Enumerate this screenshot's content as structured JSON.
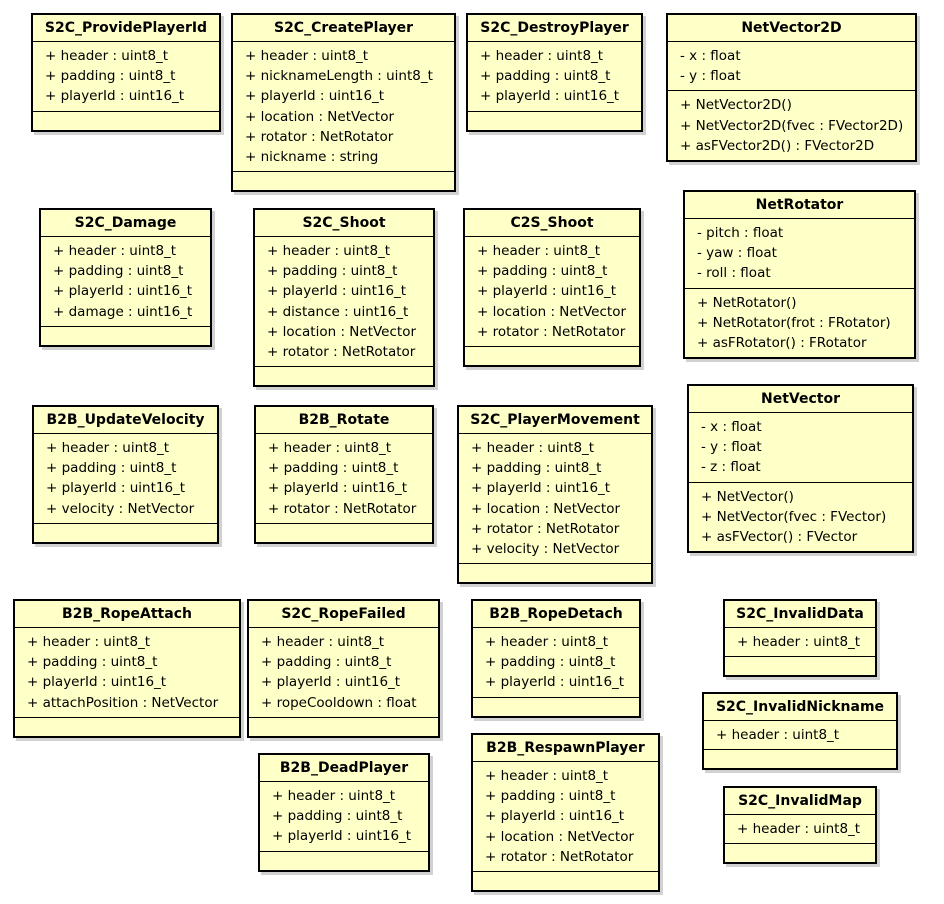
{
  "classes": {
    "s2c_provideplayerid": {
      "name": "S2C_ProvidePlayerId",
      "fields": [
        "+ header : uint8_t",
        "+ padding : uint8_t",
        "+ playerId : uint16_t"
      ],
      "methods": []
    },
    "s2c_createplayer": {
      "name": "S2C_CreatePlayer",
      "fields": [
        "+ header : uint8_t",
        "+ nicknameLength : uint8_t",
        "+ playerId : uint16_t",
        "+ location : NetVector",
        "+ rotator : NetRotator",
        "+ nickname : string"
      ],
      "methods": []
    },
    "s2c_destroyplayer": {
      "name": "S2C_DestroyPlayer",
      "fields": [
        "+ header : uint8_t",
        "+ padding : uint8_t",
        "+ playerId : uint16_t"
      ],
      "methods": []
    },
    "netvector2d": {
      "name": "NetVector2D",
      "fields": [
        "- x : float",
        "- y : float"
      ],
      "methods": [
        "+ NetVector2D()",
        "+ NetVector2D(fvec : FVector2D)",
        "+ asFVector2D() : FVector2D"
      ]
    },
    "s2c_damage": {
      "name": "S2C_Damage",
      "fields": [
        "+ header : uint8_t",
        "+ padding : uint8_t",
        "+ playerId : uint16_t",
        "+ damage : uint16_t"
      ],
      "methods": []
    },
    "s2c_shoot": {
      "name": "S2C_Shoot",
      "fields": [
        "+ header : uint8_t",
        "+ padding : uint8_t",
        "+ playerId : uint16_t",
        "+ distance : uint16_t",
        "+ location : NetVector",
        "+ rotator : NetRotator"
      ],
      "methods": []
    },
    "c2s_shoot": {
      "name": "C2S_Shoot",
      "fields": [
        "+ header : uint8_t",
        "+ padding : uint8_t",
        "+ playerId : uint16_t",
        "+ location : NetVector",
        "+ rotator : NetRotator"
      ],
      "methods": []
    },
    "netrotator": {
      "name": "NetRotator",
      "fields": [
        "- pitch : float",
        "- yaw : float",
        "- roll : float"
      ],
      "methods": [
        "+ NetRotator()",
        "+ NetRotator(frot : FRotator)",
        "+ asFRotator() : FRotator"
      ]
    },
    "b2b_updatevelocity": {
      "name": "B2B_UpdateVelocity",
      "fields": [
        "+ header : uint8_t",
        "+ padding : uint8_t",
        "+ playerId : uint16_t",
        "+ velocity : NetVector"
      ],
      "methods": []
    },
    "b2b_rotate": {
      "name": "B2B_Rotate",
      "fields": [
        "+ header : uint8_t",
        "+ padding : uint8_t",
        "+ playerId : uint16_t",
        "+ rotator : NetRotator"
      ],
      "methods": []
    },
    "s2c_playermovement": {
      "name": "S2C_PlayerMovement",
      "fields": [
        "+ header : uint8_t",
        "+ padding : uint8_t",
        "+ playerId : uint16_t",
        "+ location : NetVector",
        "+ rotator : NetRotator",
        "+ velocity : NetVector"
      ],
      "methods": []
    },
    "netvector": {
      "name": "NetVector",
      "fields": [
        "- x : float",
        "- y : float",
        "- z : float"
      ],
      "methods": [
        "+ NetVector()",
        "+ NetVector(fvec : FVector)",
        "+ asFVector() : FVector"
      ]
    },
    "b2b_ropeattach": {
      "name": "B2B_RopeAttach",
      "fields": [
        "+ header : uint8_t",
        "+ padding : uint8_t",
        "+ playerId : uint16_t",
        "+ attachPosition : NetVector"
      ],
      "methods": []
    },
    "s2c_ropefailed": {
      "name": "S2C_RopeFailed",
      "fields": [
        "+ header : uint8_t",
        "+ padding : uint8_t",
        "+ playerId : uint16_t",
        "+ ropeCooldown : float"
      ],
      "methods": []
    },
    "b2b_ropedetach": {
      "name": "B2B_RopeDetach",
      "fields": [
        "+ header : uint8_t",
        "+ padding : uint8_t",
        "+ playerId : uint16_t"
      ],
      "methods": []
    },
    "s2c_invaliddata": {
      "name": "S2C_InvalidData",
      "fields": [
        "+ header : uint8_t"
      ],
      "methods": []
    },
    "s2c_invalidnickname": {
      "name": "S2C_InvalidNickname",
      "fields": [
        "+ header : uint8_t"
      ],
      "methods": []
    },
    "b2b_deadplayer": {
      "name": "B2B_DeadPlayer",
      "fields": [
        "+ header : uint8_t",
        "+ padding : uint8_t",
        "+ playerId : uint16_t"
      ],
      "methods": []
    },
    "b2b_respawnplayer": {
      "name": "B2B_RespawnPlayer",
      "fields": [
        "+ header : uint8_t",
        "+ padding : uint8_t",
        "+ playerId : uint16_t",
        "+ location : NetVector",
        "+ rotator : NetRotator"
      ],
      "methods": []
    },
    "s2c_invalidmap": {
      "name": "S2C_InvalidMap",
      "fields": [
        "+ header : uint8_t"
      ],
      "methods": []
    }
  },
  "colors": {
    "box_fill": "#ffffc8",
    "border": "#000000"
  }
}
